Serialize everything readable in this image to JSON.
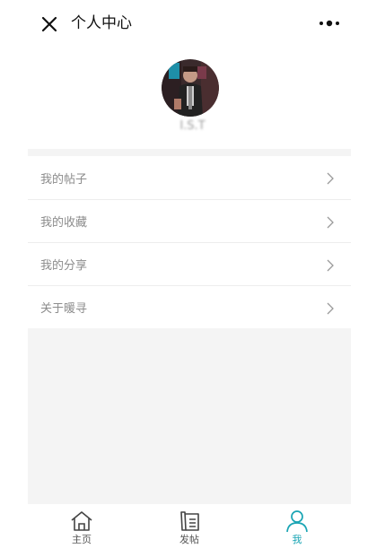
{
  "header": {
    "title": "个人中心",
    "close_icon": "close-icon",
    "more_icon": "more-dots-icon"
  },
  "profile": {
    "username": "I.S.T",
    "avatar_icon": "avatar-photo"
  },
  "menu": {
    "items": [
      {
        "label": "我的帖子",
        "icon": "chevron-right-icon"
      },
      {
        "label": "我的收藏",
        "icon": "chevron-right-icon"
      },
      {
        "label": "我的分享",
        "icon": "chevron-right-icon"
      },
      {
        "label": "关于暖寻",
        "icon": "chevron-right-icon"
      }
    ]
  },
  "tabbar": {
    "tabs": [
      {
        "label": "主页",
        "icon": "home-icon",
        "active": false
      },
      {
        "label": "发帖",
        "icon": "post-scroll-icon",
        "active": false
      },
      {
        "label": "我",
        "icon": "user-icon",
        "active": true
      }
    ]
  },
  "colors": {
    "accent": "#1aa5b4",
    "panel_bg": "#f4f4f4",
    "menu_text": "#8c8c8c"
  }
}
